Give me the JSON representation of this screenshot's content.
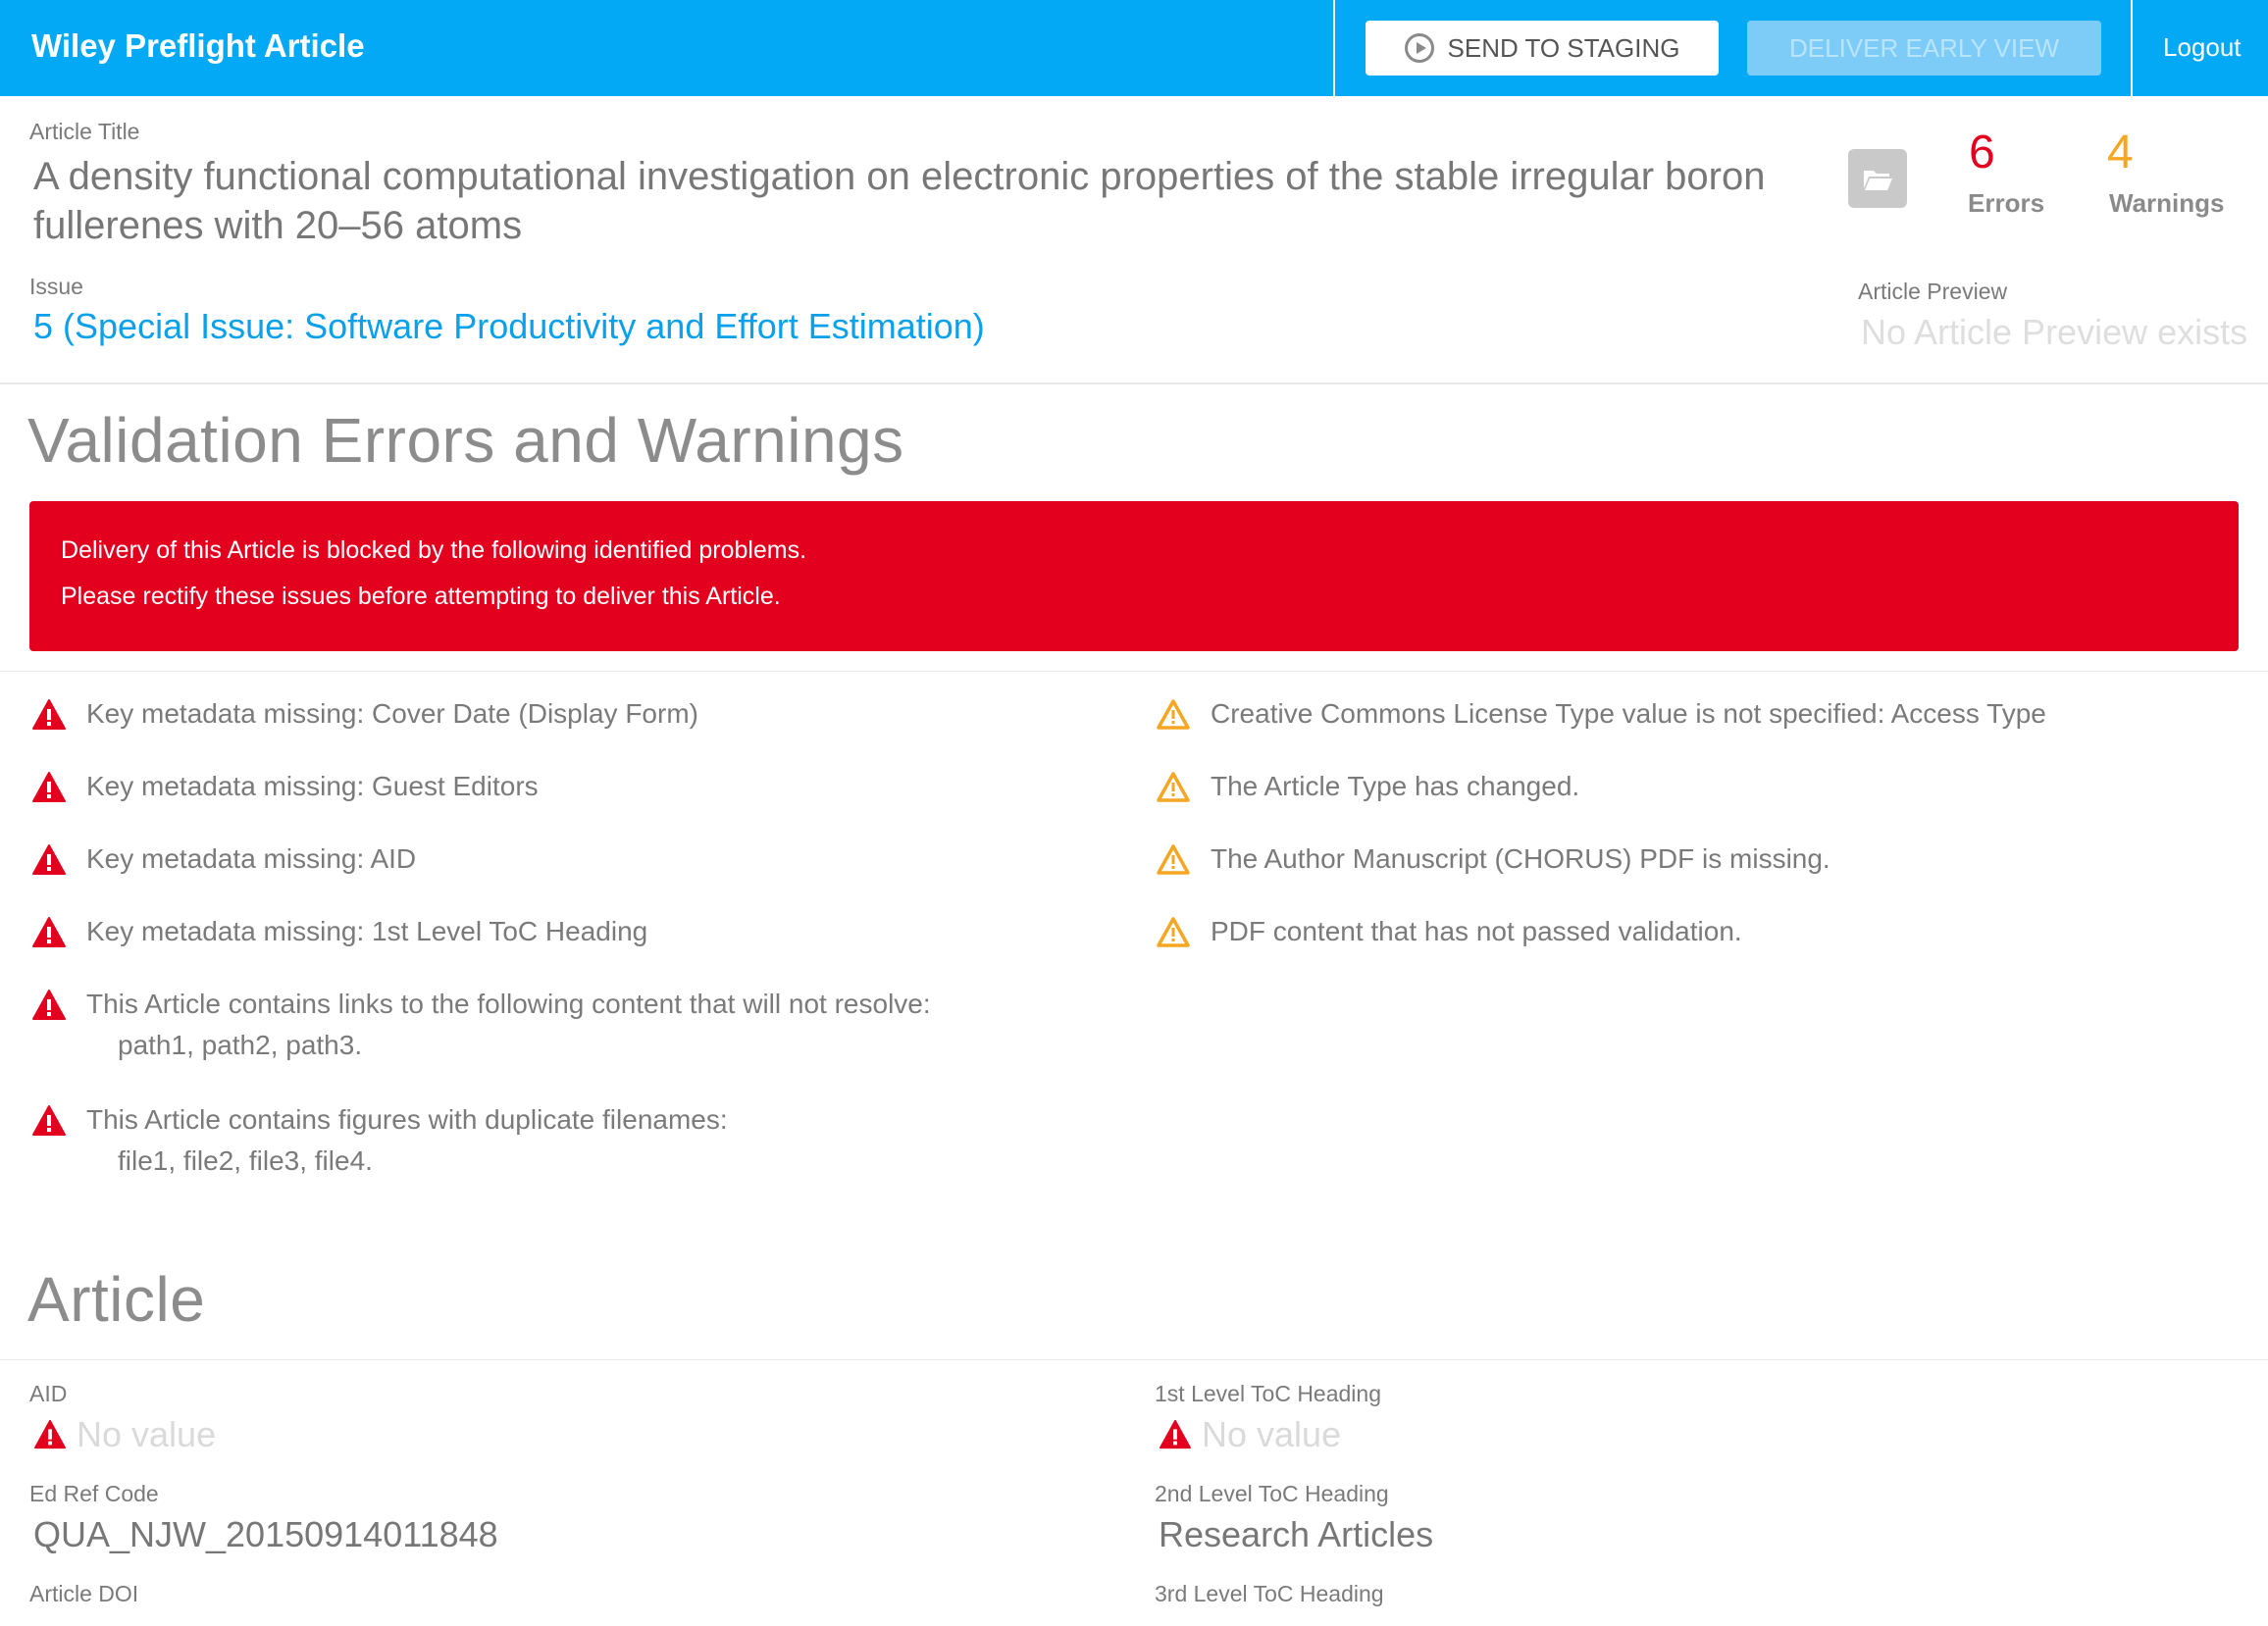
{
  "header": {
    "app_title": "Wiley Preflight Article",
    "send_to_staging": "SEND TO STAGING",
    "deliver_early_view": "DELIVER EARLY VIEW",
    "logout": "Logout"
  },
  "article": {
    "title_label": "Article Title",
    "title": "A density functional computational investigation on electronic properties of the stable irregular boron fullerenes with 20–56 atoms",
    "issue_label": "Issue",
    "issue": "5 (Special Issue: Software Productivity and Effort Estimation)",
    "errors_count": "6",
    "errors_label": "Errors",
    "warnings_count": "4",
    "warnings_label": "Warnings",
    "preview_label": "Article Preview",
    "preview_value": "No Article Preview exists"
  },
  "validation": {
    "title": "Validation Errors and Warnings",
    "alert_line1": "Delivery of this Article is blocked by the following identified problems.",
    "alert_line2": "Please rectify these issues before attempting to deliver this Article.",
    "errors": [
      {
        "text": "Key metadata missing: Cover Date (Display Form)",
        "sub": ""
      },
      {
        "text": "Key metadata missing: Guest Editors",
        "sub": ""
      },
      {
        "text": "Key metadata missing: AID",
        "sub": ""
      },
      {
        "text": "Key metadata missing: 1st Level ToC Heading",
        "sub": ""
      },
      {
        "text": "This Article contains links to the following content that will not resolve:",
        "sub": "path1, path2, path3."
      },
      {
        "text": "This Article contains figures with duplicate filenames:",
        "sub": "file1, file2, file3, file4."
      }
    ],
    "warnings": [
      {
        "text": "Creative Commons License Type value is not specified: Access Type"
      },
      {
        "text": "The Article Type has changed."
      },
      {
        "text": "The Author Manuscript (CHORUS) PDF is missing."
      },
      {
        "text": "PDF content that has not passed validation."
      }
    ]
  },
  "article_section": {
    "title": "Article",
    "aid_label": "AID",
    "aid_value": "No value",
    "toc1_label": "1st Level ToC Heading",
    "toc1_value": "No value",
    "edref_label": "Ed Ref Code",
    "edref_value": "QUA_NJW_20150914011848",
    "toc2_label": "2nd Level ToC Heading",
    "toc2_value": "Research Articles",
    "doi_label": "Article DOI",
    "toc3_label": "3rd Level ToC Heading"
  },
  "colors": {
    "brand": "#03a9f4",
    "error": "#e3001f",
    "warning": "#f5a623"
  }
}
